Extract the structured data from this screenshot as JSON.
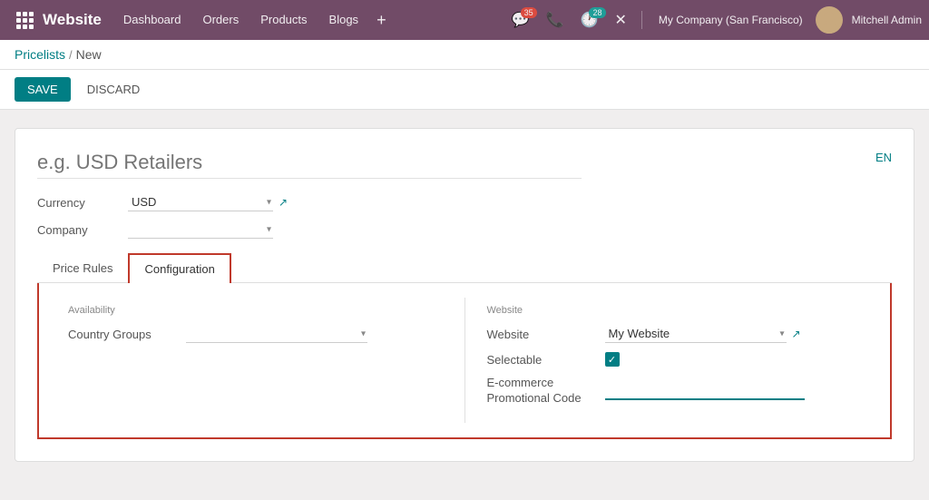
{
  "topnav": {
    "brand": "Website",
    "menu": [
      {
        "label": "Dashboard",
        "id": "dashboard"
      },
      {
        "label": "Orders",
        "id": "orders"
      },
      {
        "label": "Products",
        "id": "products"
      },
      {
        "label": "Blogs",
        "id": "blogs"
      }
    ],
    "plus_label": "+",
    "messages_badge": "35",
    "clock_badge": "28",
    "company": "My Company (San Francisco)",
    "username": "Mitchell Admin"
  },
  "breadcrumb": {
    "parent": "Pricelists",
    "separator": "/",
    "current": "New"
  },
  "actions": {
    "save": "SAVE",
    "discard": "DISCARD"
  },
  "form": {
    "name_placeholder": "e.g. USD Retailers",
    "lang": "EN",
    "fields": {
      "currency_label": "Currency",
      "currency_value": "USD",
      "company_label": "Company",
      "company_value": ""
    },
    "tabs": [
      {
        "label": "Price Rules",
        "id": "price-rules",
        "active": false
      },
      {
        "label": "Configuration",
        "id": "configuration",
        "active": true
      }
    ],
    "configuration": {
      "availability_section": "Availability",
      "country_groups_label": "Country Groups",
      "country_groups_value": "",
      "website_section": "Website",
      "website_label": "Website",
      "website_value": "My Website",
      "selectable_label": "Selectable",
      "selectable_checked": true,
      "ecommerce_label_line1": "E-commerce",
      "ecommerce_label_line2": "Promotional Code",
      "promo_code_value": ""
    }
  },
  "icons": {
    "grid": "⊞",
    "chevron_down": "▾",
    "external_link": "↗",
    "phone": "📞",
    "chat": "💬",
    "wrench": "✕",
    "checkmark": "✓"
  }
}
